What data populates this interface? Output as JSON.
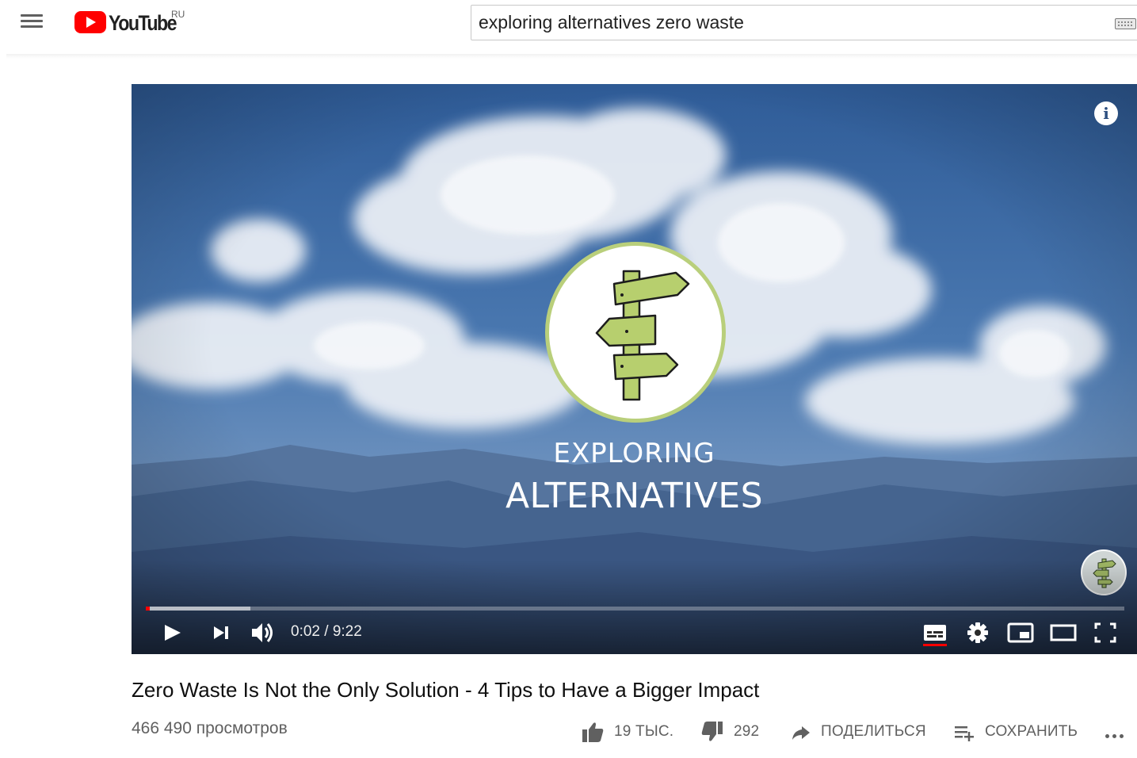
{
  "masthead": {
    "logo_text": "YouTube",
    "region": "RU",
    "search_value": "exploring alternatives zero waste",
    "icons": [
      "menu-icon",
      "youtube-logo-icon",
      "keyboard-icon"
    ],
    "brand_color": "#ff0000"
  },
  "player": {
    "overlay_title_line1": "EXPLORING",
    "overlay_title_line2": "ALTERNATIVES",
    "current_time": "0:02",
    "duration": "9:22",
    "time_display": "0:02 / 9:22",
    "played_fraction": 0.004,
    "buffered_fraction": 0.107,
    "icons": [
      "info-icon",
      "play-icon",
      "next-icon",
      "volume-icon",
      "subtitles-icon",
      "settings-icon",
      "miniplayer-icon",
      "theater-mode-icon",
      "fullscreen-icon",
      "channel-watermark-icon"
    ],
    "progress_color": "#ff0000"
  },
  "video": {
    "title": "Zero Waste Is Not the Only Solution - 4 Tips to Have a Bigger Impact",
    "views": "466 490 просмотров",
    "likes": "19 ТЫС.",
    "dislikes": "292",
    "share_label": "ПОДЕЛИТЬСЯ",
    "save_label": "СОХРАНИТЬ"
  }
}
